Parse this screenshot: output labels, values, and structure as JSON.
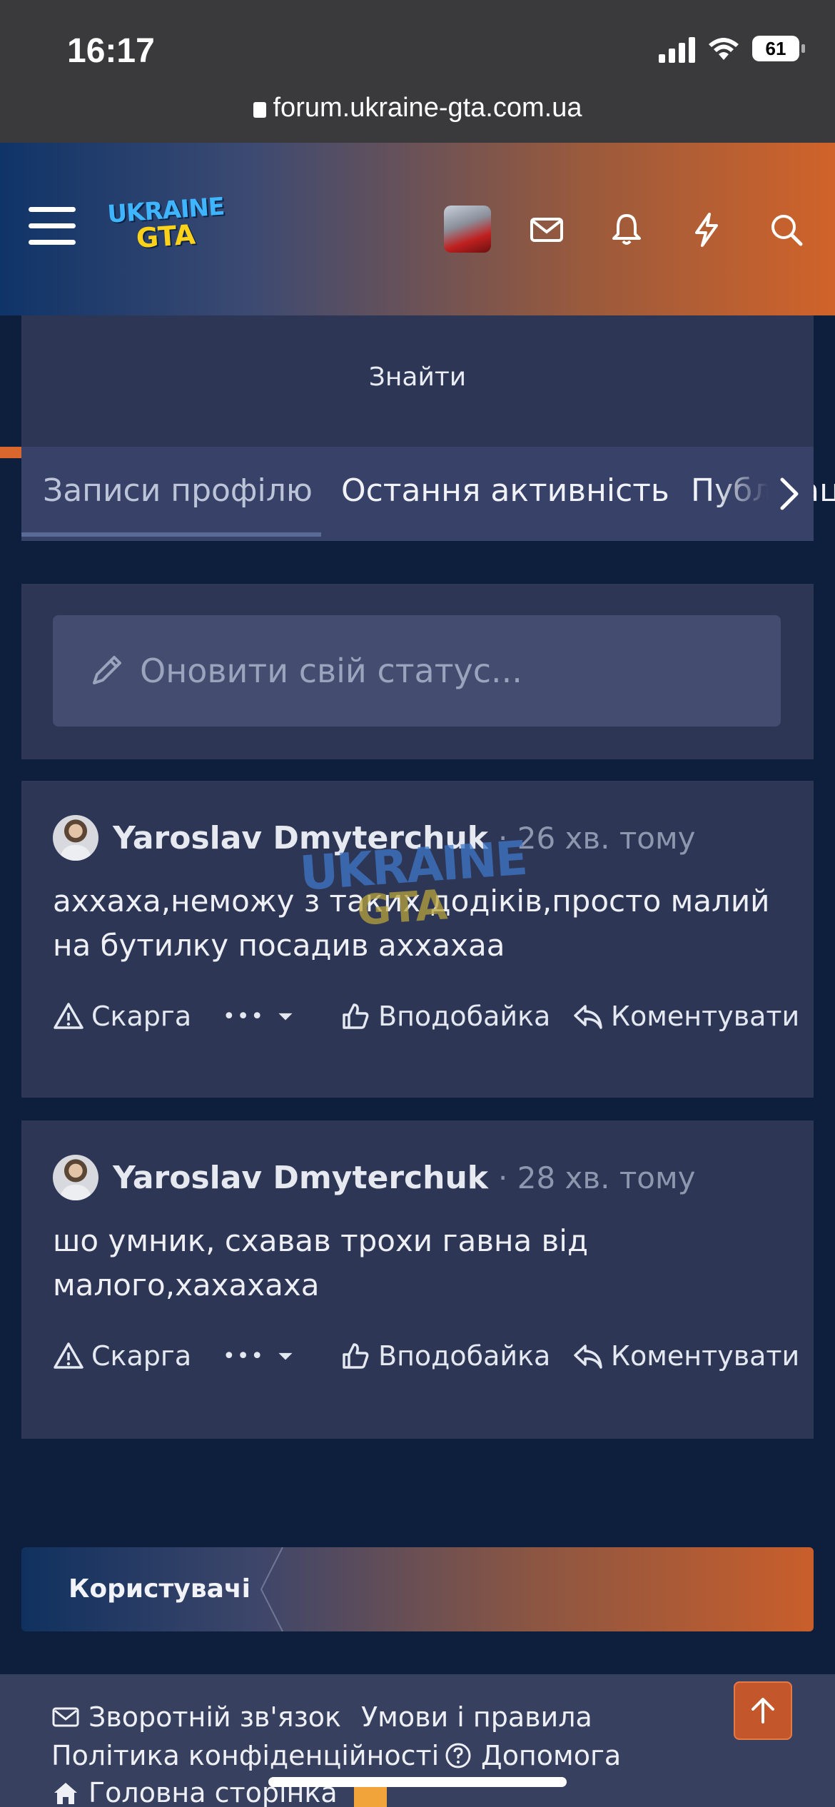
{
  "status_bar": {
    "time": "16:17",
    "battery": "61"
  },
  "browser": {
    "url": "forum.ukraine-gta.com.ua"
  },
  "header": {
    "logo_line1": "UKRAINE",
    "logo_line2": "GTA"
  },
  "search": {
    "button_label": "Знайти"
  },
  "tabs": [
    {
      "label": "Записи профілю",
      "active": true
    },
    {
      "label": "Остання активність",
      "active": false
    },
    {
      "label": "Публікації",
      "active": false
    }
  ],
  "status_update": {
    "placeholder": "Оновити свій статус..."
  },
  "posts": [
    {
      "author": "Yaroslav Dmyterchuk",
      "time": "· 26 хв. тому",
      "body": "аххаха,неможу з таких додіків,просто малий на бутилку посадив аххахаа"
    },
    {
      "author": "Yaroslav Dmyterchuk",
      "time": "· 28 хв. тому",
      "body": "шо умник, схавав трохи гавна від малого,хахахаха"
    }
  ],
  "post_actions": {
    "report": "Скарга",
    "more": "•••",
    "like": "Вподобайка",
    "comment": "Коментувати"
  },
  "users_block": {
    "label": "Користувачі"
  },
  "footer": {
    "contact": "Зворотній зв'язок",
    "terms": "Умови і правила",
    "privacy": "Політика конфіденційності",
    "help": "Допомога",
    "home": "Головна сторінка"
  },
  "colors": {
    "page_bg": "#0d1f3c",
    "card_bg": "#2e3656",
    "accent_orange": "#d9662d",
    "header_blue": "#0f3468"
  }
}
